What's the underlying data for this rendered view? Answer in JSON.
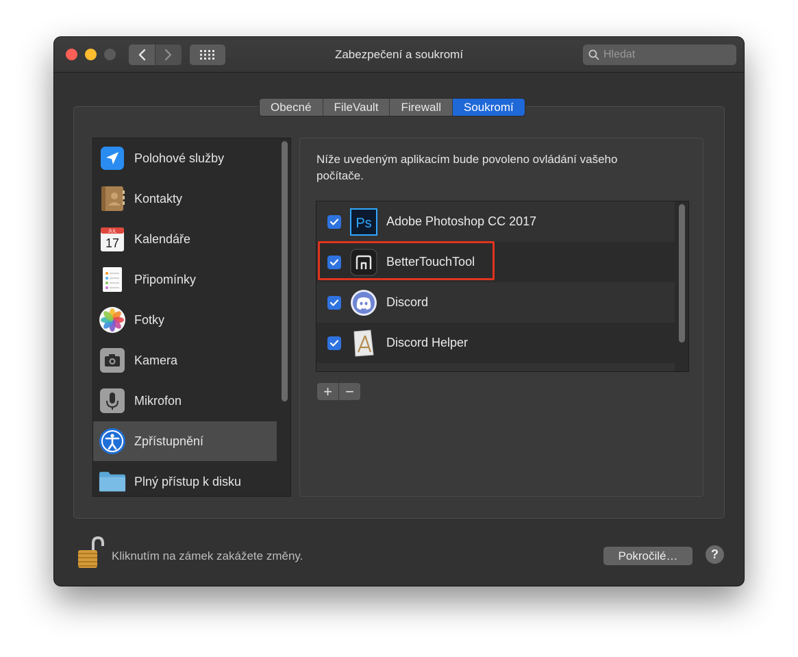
{
  "window": {
    "title": "Zabezpečení a soukromí",
    "search_placeholder": "Hledat"
  },
  "tabs": [
    {
      "label": "Obecné",
      "active": false
    },
    {
      "label": "FileVault",
      "active": false
    },
    {
      "label": "Firewall",
      "active": false
    },
    {
      "label": "Soukromí",
      "active": true
    }
  ],
  "sidebar": {
    "items": [
      {
        "label": "Polohové služby",
        "icon": "location-arrow-icon"
      },
      {
        "label": "Kontakty",
        "icon": "contacts-book-icon"
      },
      {
        "label": "Kalendáře",
        "icon": "calendar-icon",
        "icon_month": "JUL",
        "icon_day": "17"
      },
      {
        "label": "Připomínky",
        "icon": "reminders-icon"
      },
      {
        "label": "Fotky",
        "icon": "photos-flower-icon"
      },
      {
        "label": "Kamera",
        "icon": "camera-icon"
      },
      {
        "label": "Mikrofon",
        "icon": "microphone-icon"
      },
      {
        "label": "Zpřístupnění",
        "icon": "accessibility-icon",
        "selected": true
      },
      {
        "label": "Plný přístup k disku",
        "icon": "folder-icon"
      }
    ]
  },
  "panel": {
    "description": "Níže uvedeným aplikacím bude povoleno ovládání vašeho počítače.",
    "apps": [
      {
        "name": "Adobe Photoshop CC 2017",
        "checked": true,
        "icon": "photoshop-icon",
        "icon_text": "Ps"
      },
      {
        "name": "BetterTouchTool",
        "checked": true,
        "icon": "bettertouchtool-icon",
        "highlighted": true
      },
      {
        "name": "Discord",
        "checked": true,
        "icon": "discord-icon"
      },
      {
        "name": "Discord Helper",
        "checked": true,
        "icon": "discord-helper-app-icon"
      }
    ],
    "add_label": "+",
    "remove_label": "−"
  },
  "footer": {
    "lock_text": "Kliknutím na zámek zakážete změny.",
    "advanced_button": "Pokročilé…",
    "help_label": "?"
  },
  "colors": {
    "accent": "#1f68d8",
    "checkbox": "#2f73e0",
    "highlight_border": "#e0341f",
    "window_bg": "#323232"
  }
}
